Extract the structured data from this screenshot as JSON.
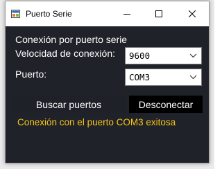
{
  "window": {
    "title": "Puerto Serie",
    "icon": "serial-app-icon",
    "controls": {
      "minimize_icon": "minimize-icon",
      "maximize_icon": "maximize-icon",
      "close_icon": "close-icon"
    }
  },
  "form": {
    "heading": "Conexión por puerto serie",
    "speed_label": "Velocidad de conexión:",
    "speed_value": "9600",
    "port_label": "Puerto:",
    "port_value": "COM3",
    "search_button": "Buscar puertos",
    "disconnect_button": "Desconectar",
    "status_text": "Conexión con el puerto COM3 exitosa"
  },
  "colors": {
    "client_background": "#202229",
    "status_text": "#f5c518",
    "disconnect_button": "#000000"
  }
}
